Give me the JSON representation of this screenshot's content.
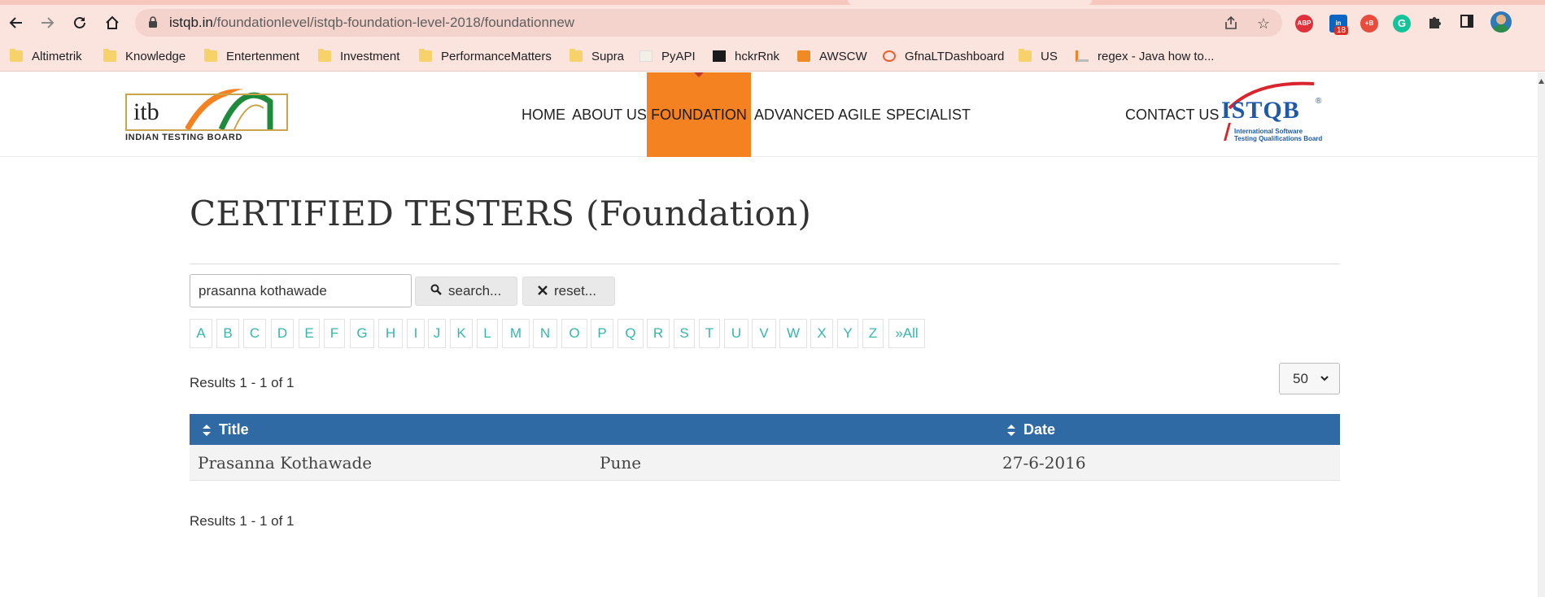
{
  "browser": {
    "url_host": "istqb.in",
    "url_path": "/foundationlevel/istqb-foundation-level-2018/foundationnew",
    "icons": [
      "back-icon",
      "forward-icon",
      "reload-icon",
      "home-icon",
      "lock-icon",
      "share-icon",
      "star-icon",
      "puzzle-icon",
      "sidepanel-icon",
      "profile-icon"
    ],
    "extensions": {
      "abp": "ABP",
      "linkedin_badge": "18",
      "other": "+B"
    },
    "bookmarks": [
      "Altimetrik",
      "Knowledge",
      "Entertenment",
      "Investment",
      "PerformanceMatters",
      "Supra",
      "PyAPI",
      "hckrRnk",
      "AWSCW",
      "GfnaLTDashboard",
      "US",
      "regex - Java how to..."
    ]
  },
  "site": {
    "logo_text": "itb",
    "logo_tagline": "INDIAN TESTING BOARD",
    "nav": [
      "HOME",
      "ABOUT US",
      "FOUNDATION",
      "ADVANCED",
      "AGILE",
      "SPECIALIST",
      "CONTACT US"
    ],
    "active_nav": "FOUNDATION",
    "istqb_logo": "ISTQB",
    "istqb_reg": "®",
    "istqb_sub_1": "International Software",
    "istqb_sub_2": "Testing Qualifications Board",
    "accent_color": "#f58220",
    "table_header_color": "#2f6aa4",
    "link_color": "#36b5b0"
  },
  "main": {
    "title": "CERTIFIED TESTERS (Foundation)",
    "search": {
      "value": "prasanna kothawade",
      "search_label": "search...",
      "reset_label": "reset..."
    },
    "alphabet": [
      "A",
      "B",
      "C",
      "D",
      "E",
      "F",
      "G",
      "H",
      "I",
      "J",
      "K",
      "L",
      "M",
      "N",
      "O",
      "P",
      "Q",
      "R",
      "S",
      "T",
      "U",
      "V",
      "W",
      "X",
      "Y",
      "Z",
      "»All"
    ],
    "results_top": "Results 1 - 1 of 1",
    "results_bottom": "Results 1 - 1 of 1",
    "per_page": "50",
    "table": {
      "columns": [
        "Title",
        "Date"
      ],
      "rows": [
        [
          "Prasanna Kothawade",
          "Pune",
          "27-6-2016"
        ]
      ]
    }
  }
}
